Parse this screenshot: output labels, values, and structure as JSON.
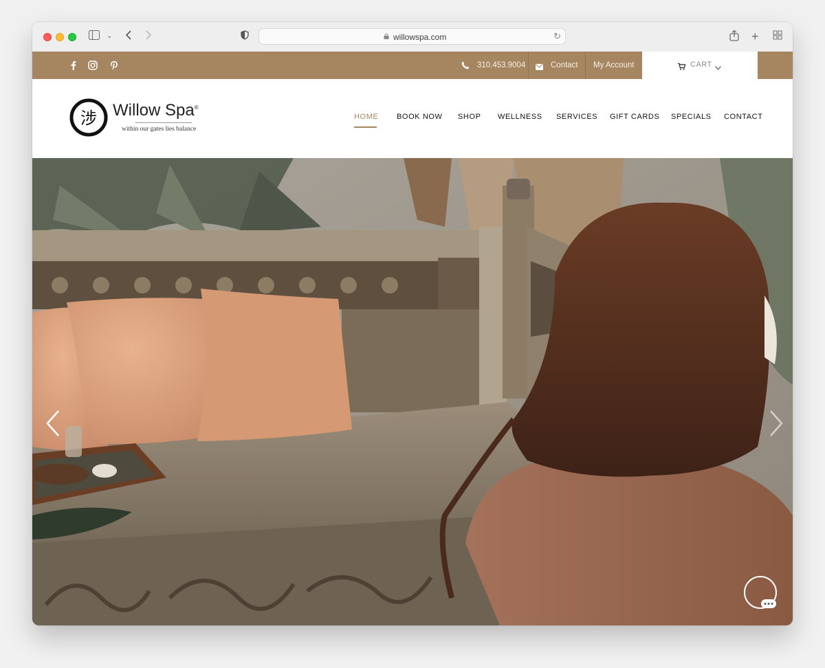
{
  "browser": {
    "url": "willowspa.com"
  },
  "topbar": {
    "phone": "310.453.9004",
    "contact": "Contact",
    "account": "My Account",
    "cart": "CART"
  },
  "brand": {
    "name": "Willow Spa",
    "trademark": "®",
    "tagline": "within our gates lies balance",
    "logo_glyph": "涉"
  },
  "nav": {
    "items": [
      {
        "label": "HOME",
        "active": true
      },
      {
        "label": "BOOK NOW",
        "active": false
      },
      {
        "label": "SHOP",
        "active": false
      },
      {
        "label": "WELLNESS",
        "active": false
      },
      {
        "label": "SERVICES",
        "active": false
      },
      {
        "label": "GIFT CARDS",
        "active": false
      },
      {
        "label": "SPECIALS",
        "active": false
      },
      {
        "label": "CONTACT",
        "active": false
      }
    ]
  },
  "colors": {
    "accent": "#a68661",
    "active_nav": "#a68661"
  },
  "icons": {
    "social": [
      "facebook-icon",
      "instagram-icon",
      "pinterest-icon"
    ],
    "topbar": [
      "phone-icon",
      "envelope-icon",
      "cart-icon",
      "chevron-down-icon"
    ],
    "hero": [
      "slider-prev-arrow-icon",
      "slider-next-arrow-icon",
      "chat-icon"
    ]
  }
}
